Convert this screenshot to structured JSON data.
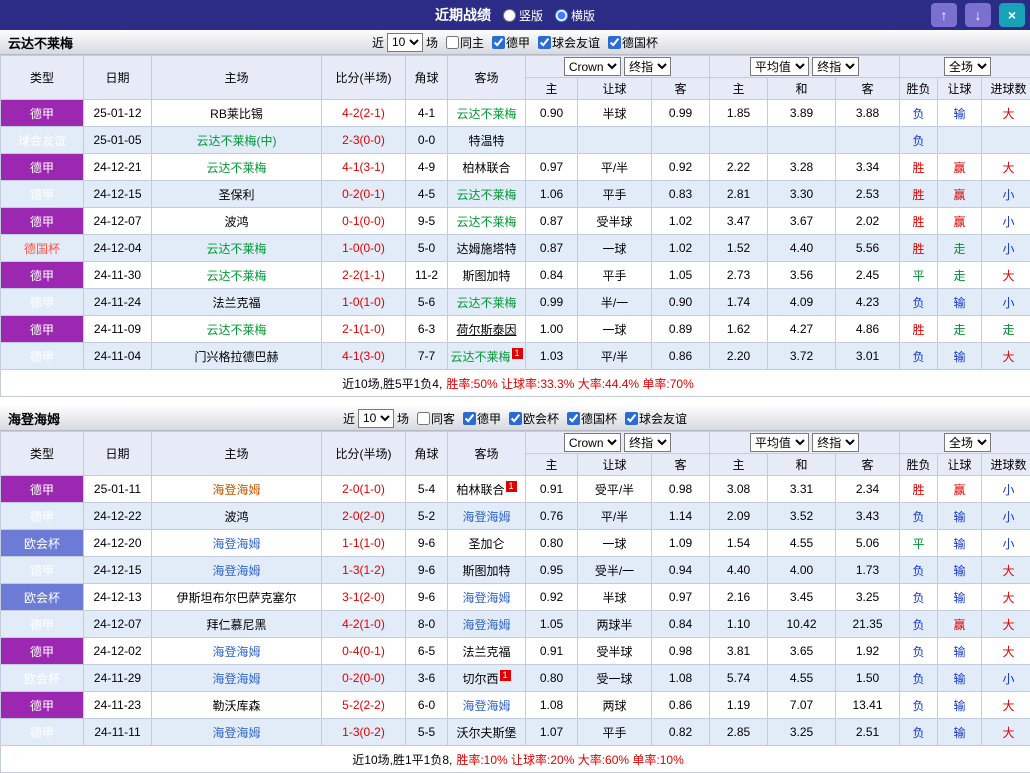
{
  "colors": {
    "titlebar_bg": "#2A2C85",
    "league_dejia_bg": "#9C27B0",
    "league_friendly_bg": "#00A0A5",
    "league_uecl_bg": "#6B7BD6",
    "focus_team_green": "#009933",
    "focus_team_blue": "#3366CC",
    "win_red": "#E00000",
    "loss_blue": "#1538C8",
    "draw_green": "#009030"
  },
  "titlebar": {
    "title": "近期战绩",
    "view_options": [
      {
        "label": "竖版",
        "selected": false
      },
      {
        "label": "横版",
        "selected": true
      }
    ],
    "buttons": {
      "up": "↑",
      "down": "↓",
      "close": "×"
    }
  },
  "sections": [
    {
      "team": "云达不莱梅",
      "filter": {
        "prefix": "近",
        "count": "10",
        "suffix": "场",
        "checkboxes": [
          {
            "label": "同主",
            "checked": false
          },
          {
            "label": "德甲",
            "checked": true
          },
          {
            "label": "球会友谊",
            "checked": true
          },
          {
            "label": "德国杯",
            "checked": true
          }
        ]
      },
      "header": {
        "cols": [
          "类型",
          "日期",
          "主场",
          "比分(半场)",
          "角球",
          "客场"
        ],
        "group1": {
          "selects": [
            "Crown",
            "终指"
          ],
          "cols": [
            "主",
            "让球",
            "客"
          ]
        },
        "group2": {
          "selects": [
            "平均值",
            "终指"
          ],
          "cols": [
            "主",
            "和",
            "客"
          ]
        },
        "group3": {
          "selects": [
            "全场"
          ],
          "cols": [
            "胜负",
            "让球",
            "进球数"
          ]
        }
      },
      "rows": [
        {
          "league": "德甲",
          "date": "25-01-12",
          "home": {
            "name": "RB莱比锡"
          },
          "score": "4-2(2-1)",
          "corners": "4-1",
          "away": {
            "name": "云达不莱梅",
            "color": "green"
          },
          "crown_home": "0.90",
          "handicap": "半球",
          "crown_away": "0.99",
          "avg_home": "1.85",
          "avg_draw": "3.89",
          "avg_away": "3.88",
          "result": "负",
          "handicap_result": "输",
          "goals_result": "大"
        },
        {
          "league": "球会友谊",
          "date": "25-01-05",
          "home": {
            "name": "云达不莱梅(中)",
            "color": "green"
          },
          "score": "2-3(0-0)",
          "corners": "0-0",
          "away": {
            "name": "特温特"
          },
          "crown_home": "",
          "handicap": "",
          "crown_away": "",
          "avg_home": "",
          "avg_draw": "",
          "avg_away": "",
          "result": "负",
          "handicap_result": "",
          "goals_result": ""
        },
        {
          "league": "德甲",
          "date": "24-12-21",
          "home": {
            "name": "云达不莱梅",
            "color": "green"
          },
          "score": "4-1(3-1)",
          "corners": "4-9",
          "away": {
            "name": "柏林联合"
          },
          "crown_home": "0.97",
          "handicap": "平/半",
          "crown_away": "0.92",
          "avg_home": "2.22",
          "avg_draw": "3.28",
          "avg_away": "3.34",
          "result": "胜",
          "handicap_result": "赢",
          "goals_result": "大"
        },
        {
          "league": "德甲",
          "date": "24-12-15",
          "home": {
            "name": "圣保利"
          },
          "score": "0-2(0-1)",
          "corners": "4-5",
          "away": {
            "name": "云达不莱梅",
            "color": "green"
          },
          "crown_home": "1.06",
          "handicap": "平手",
          "crown_away": "0.83",
          "avg_home": "2.81",
          "avg_draw": "3.30",
          "avg_away": "2.53",
          "result": "胜",
          "handicap_result": "赢",
          "goals_result": "小"
        },
        {
          "league": "德甲",
          "date": "24-12-07",
          "home": {
            "name": "波鸿"
          },
          "score": "0-1(0-0)",
          "corners": "9-5",
          "away": {
            "name": "云达不莱梅",
            "color": "green"
          },
          "crown_home": "0.87",
          "handicap": "受半球",
          "crown_away": "1.02",
          "avg_home": "3.47",
          "avg_draw": "3.67",
          "avg_away": "2.02",
          "result": "胜",
          "handicap_result": "赢",
          "goals_result": "小"
        },
        {
          "league": "德国杯",
          "date": "24-12-04",
          "home": {
            "name": "云达不莱梅",
            "color": "green"
          },
          "score": "1-0(0-0)",
          "corners": "5-0",
          "away": {
            "name": "达姆施塔特"
          },
          "crown_home": "0.87",
          "handicap": "一球",
          "crown_away": "1.02",
          "avg_home": "1.52",
          "avg_draw": "4.40",
          "avg_away": "5.56",
          "result": "胜",
          "handicap_result": "走",
          "goals_result": "小"
        },
        {
          "league": "德甲",
          "date": "24-11-30",
          "home": {
            "name": "云达不莱梅",
            "color": "green"
          },
          "score": "2-2(1-1)",
          "corners": "11-2",
          "away": {
            "name": "斯图加特"
          },
          "crown_home": "0.84",
          "handicap": "平手",
          "crown_away": "1.05",
          "avg_home": "2.73",
          "avg_draw": "3.56",
          "avg_away": "2.45",
          "result": "平",
          "handicap_result": "走",
          "goals_result": "大"
        },
        {
          "league": "德甲",
          "date": "24-11-24",
          "home": {
            "name": "法兰克福"
          },
          "score": "1-0(1-0)",
          "corners": "5-6",
          "away": {
            "name": "云达不莱梅",
            "color": "green"
          },
          "crown_home": "0.99",
          "handicap": "半/一",
          "crown_away": "0.90",
          "avg_home": "1.74",
          "avg_draw": "4.09",
          "avg_away": "4.23",
          "result": "负",
          "handicap_result": "输",
          "goals_result": "小"
        },
        {
          "league": "德甲",
          "date": "24-11-09",
          "home": {
            "name": "云达不莱梅",
            "color": "green"
          },
          "score": "2-1(1-0)",
          "corners": "6-3",
          "away": {
            "name": "荷尔斯泰因",
            "underline": true
          },
          "crown_home": "1.00",
          "handicap": "一球",
          "crown_away": "0.89",
          "avg_home": "1.62",
          "avg_draw": "4.27",
          "avg_away": "4.86",
          "result": "胜",
          "handicap_result": "走",
          "goals_result": "走"
        },
        {
          "league": "德甲",
          "date": "24-11-04",
          "home": {
            "name": "门兴格拉德巴赫"
          },
          "score": "4-1(3-0)",
          "corners": "7-7",
          "away": {
            "name": "云达不莱梅",
            "color": "green",
            "card": "1"
          },
          "crown_home": "1.03",
          "handicap": "平/半",
          "crown_away": "0.86",
          "avg_home": "2.20",
          "avg_draw": "3.72",
          "avg_away": "3.01",
          "result": "负",
          "handicap_result": "输",
          "goals_result": "大"
        }
      ],
      "summary": {
        "record": "近10场,胜5平1负4,",
        "stats": "胜率:50% 让球率:33.3% 大率:44.4% 单率:70%"
      }
    },
    {
      "team": "海登海姆",
      "filter": {
        "prefix": "近",
        "count": "10",
        "suffix": "场",
        "checkboxes": [
          {
            "label": "同客",
            "checked": false
          },
          {
            "label": "德甲",
            "checked": true
          },
          {
            "label": "欧会杯",
            "checked": true
          },
          {
            "label": "德国杯",
            "checked": true
          },
          {
            "label": "球会友谊",
            "checked": true
          }
        ]
      },
      "header": {
        "cols": [
          "类型",
          "日期",
          "主场",
          "比分(半场)",
          "角球",
          "客场"
        ],
        "group1": {
          "selects": [
            "Crown",
            "终指"
          ],
          "cols": [
            "主",
            "让球",
            "客"
          ]
        },
        "group2": {
          "selects": [
            "平均值",
            "终指"
          ],
          "cols": [
            "主",
            "和",
            "客"
          ]
        },
        "group3": {
          "selects": [
            "全场"
          ],
          "cols": [
            "胜负",
            "让球",
            "进球数"
          ]
        }
      },
      "rows": [
        {
          "league": "德甲",
          "date": "25-01-11",
          "home": {
            "name": "海登海姆",
            "color": "orange"
          },
          "score": "2-0(1-0)",
          "corners": "5-4",
          "away": {
            "name": "柏林联合",
            "card": "1"
          },
          "crown_home": "0.91",
          "handicap": "受平/半",
          "crown_away": "0.98",
          "avg_home": "3.08",
          "avg_draw": "3.31",
          "avg_away": "2.34",
          "result": "胜",
          "handicap_result": "赢",
          "goals_result": "小"
        },
        {
          "league": "德甲",
          "date": "24-12-22",
          "home": {
            "name": "波鸿"
          },
          "score": "2-0(2-0)",
          "corners": "5-2",
          "away": {
            "name": "海登海姆",
            "color": "blue"
          },
          "crown_home": "0.76",
          "handicap": "平/半",
          "crown_away": "1.14",
          "avg_home": "2.09",
          "avg_draw": "3.52",
          "avg_away": "3.43",
          "result": "负",
          "handicap_result": "输",
          "goals_result": "小"
        },
        {
          "league": "欧会杯",
          "date": "24-12-20",
          "home": {
            "name": "海登海姆",
            "color": "blue"
          },
          "score": "1-1(1-0)",
          "corners": "9-6",
          "away": {
            "name": "圣加仑"
          },
          "crown_home": "0.80",
          "handicap": "一球",
          "crown_away": "1.09",
          "avg_home": "1.54",
          "avg_draw": "4.55",
          "avg_away": "5.06",
          "result": "平",
          "handicap_result": "输",
          "goals_result": "小"
        },
        {
          "league": "德甲",
          "date": "24-12-15",
          "home": {
            "name": "海登海姆",
            "color": "blue"
          },
          "score": "1-3(1-2)",
          "corners": "9-6",
          "away": {
            "name": "斯图加特"
          },
          "crown_home": "0.95",
          "handicap": "受半/一",
          "crown_away": "0.94",
          "avg_home": "4.40",
          "avg_draw": "4.00",
          "avg_away": "1.73",
          "result": "负",
          "handicap_result": "输",
          "goals_result": "大"
        },
        {
          "league": "欧会杯",
          "date": "24-12-13",
          "home": {
            "name": "伊斯坦布尔巴萨克塞尔"
          },
          "score": "3-1(2-0)",
          "corners": "9-6",
          "away": {
            "name": "海登海姆",
            "color": "blue"
          },
          "crown_home": "0.92",
          "handicap": "半球",
          "crown_away": "0.97",
          "avg_home": "2.16",
          "avg_draw": "3.45",
          "avg_away": "3.25",
          "result": "负",
          "handicap_result": "输",
          "goals_result": "大"
        },
        {
          "league": "德甲",
          "date": "24-12-07",
          "home": {
            "name": "拜仁慕尼黑"
          },
          "score": "4-2(1-0)",
          "corners": "8-0",
          "away": {
            "name": "海登海姆",
            "color": "blue"
          },
          "crown_home": "1.05",
          "handicap": "两球半",
          "crown_away": "0.84",
          "avg_home": "1.10",
          "avg_draw": "10.42",
          "avg_away": "21.35",
          "result": "负",
          "handicap_result": "赢",
          "goals_result": "大"
        },
        {
          "league": "德甲",
          "date": "24-12-02",
          "home": {
            "name": "海登海姆",
            "color": "blue"
          },
          "score": "0-4(0-1)",
          "corners": "6-5",
          "away": {
            "name": "法兰克福"
          },
          "crown_home": "0.91",
          "handicap": "受半球",
          "crown_away": "0.98",
          "avg_home": "3.81",
          "avg_draw": "3.65",
          "avg_away": "1.92",
          "result": "负",
          "handicap_result": "输",
          "goals_result": "大"
        },
        {
          "league": "欧会杯",
          "date": "24-11-29",
          "home": {
            "name": "海登海姆",
            "color": "blue"
          },
          "score": "0-2(0-0)",
          "corners": "3-6",
          "away": {
            "name": "切尔西",
            "card": "1"
          },
          "crown_home": "0.80",
          "handicap": "受一球",
          "crown_away": "1.08",
          "avg_home": "5.74",
          "avg_draw": "4.55",
          "avg_away": "1.50",
          "result": "负",
          "handicap_result": "输",
          "goals_result": "小"
        },
        {
          "league": "德甲",
          "date": "24-11-23",
          "home": {
            "name": "勒沃库森"
          },
          "score": "5-2(2-2)",
          "corners": "6-0",
          "away": {
            "name": "海登海姆",
            "color": "blue"
          },
          "crown_home": "1.08",
          "handicap": "两球",
          "crown_away": "0.86",
          "avg_home": "1.19",
          "avg_draw": "7.07",
          "avg_away": "13.41",
          "result": "负",
          "handicap_result": "输",
          "goals_result": "大"
        },
        {
          "league": "德甲",
          "date": "24-11-11",
          "home": {
            "name": "海登海姆",
            "color": "blue"
          },
          "score": "1-3(0-2)",
          "corners": "5-5",
          "away": {
            "name": "沃尔夫斯堡"
          },
          "crown_home": "1.07",
          "handicap": "平手",
          "crown_away": "0.82",
          "avg_home": "2.85",
          "avg_draw": "3.25",
          "avg_away": "2.51",
          "result": "负",
          "handicap_result": "输",
          "goals_result": "大"
        }
      ],
      "summary": {
        "record": "近10场,胜1平1负8,",
        "stats": "胜率:10% 让球率:20% 大率:60% 单率:10%"
      }
    }
  ]
}
